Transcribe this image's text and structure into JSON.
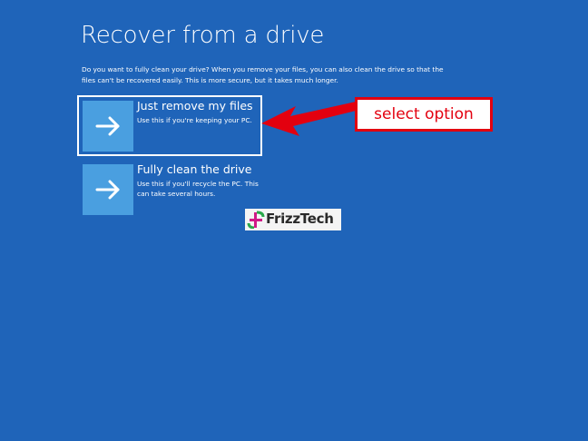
{
  "screen": {
    "background": "#1f64b9",
    "title": "Recover from a drive",
    "description": "Do you want to fully clean your drive? When you remove your files, you can also clean the drive so that the files can't be recovered easily. This is more secure, but it takes much longer."
  },
  "options": [
    {
      "title": "Just remove my files",
      "description": "Use this if you're keeping your PC.",
      "icon": "arrow-right-icon",
      "selected": true
    },
    {
      "title": "Fully clean the drive",
      "description": "Use this if you'll recycle the PC. This can take several hours.",
      "icon": "arrow-right-icon",
      "selected": false
    }
  ],
  "annotation": {
    "label": "select option",
    "color": "#e3000f"
  },
  "watermark": {
    "text": "FrizzTech"
  },
  "colors": {
    "tile": "#4a9fe0",
    "text": "#ffffff"
  }
}
